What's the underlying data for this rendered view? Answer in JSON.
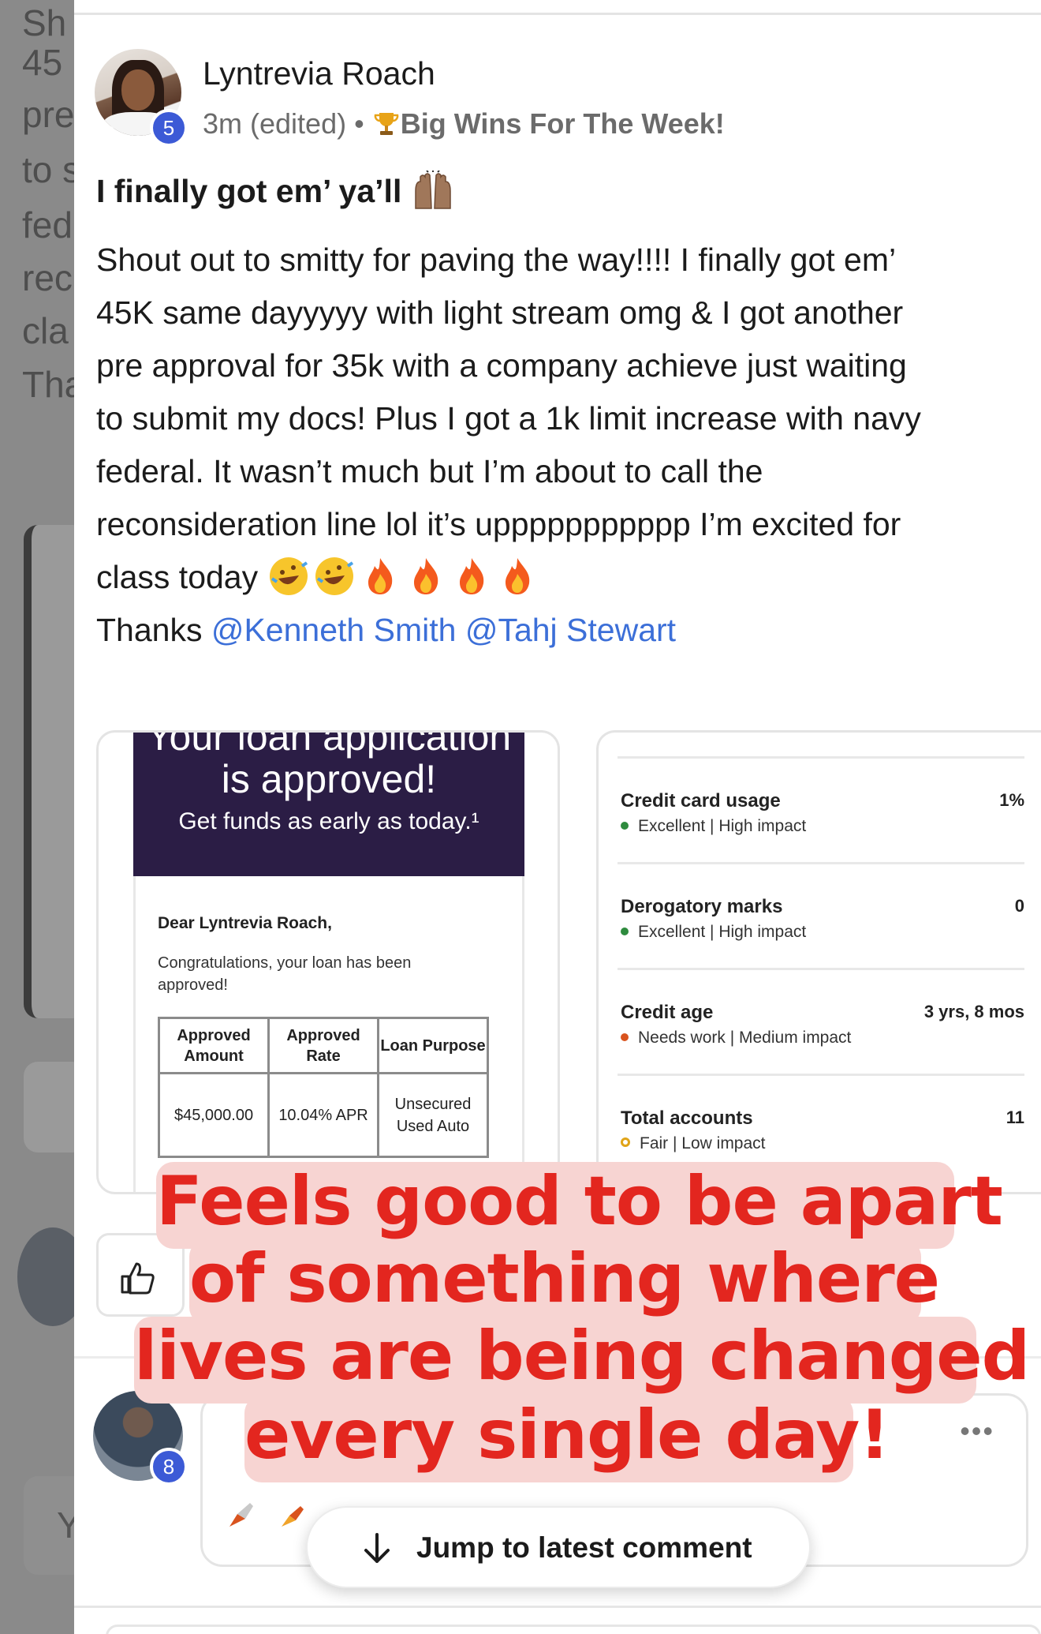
{
  "background": {
    "fragments": [
      "Sh",
      "45",
      "pre",
      "to s",
      "fed",
      "rec",
      "cla",
      "Tha"
    ],
    "bottom_letter": "Y"
  },
  "post": {
    "author": "Lyntrevia Roach",
    "author_level": "5",
    "time": "3m (edited)",
    "separator": "•",
    "category": "Big Wins For The Week!",
    "title": "I finally got em’ ya’ll",
    "body_lines": [
      "Shout out to smitty for paving the way!!!! I finally got em’",
      "45K same dayyyyy with light stream omg & I got another",
      "pre approval for 35k with a company achieve just waiting",
      "to submit my docs! Plus I got a 1k limit increase with navy",
      "federal. It wasn’t much but I’m about to call the",
      "reconsideration line lol it’s uppppppppppp I’m excited for",
      "class today"
    ],
    "thanks_prefix": "Thanks ",
    "mentions": [
      "@Kenneth Smith",
      "@Tahj Stewart"
    ]
  },
  "loan_image": {
    "heading_line1": "Your loan application",
    "heading_line2": "is approved!",
    "subheading": "Get funds as early as today.¹",
    "greeting": "Dear Lyntrevia Roach,",
    "message": "Congratulations, your loan has been approved!",
    "table": {
      "headers": [
        "Approved Amount",
        "Approved Rate",
        "Loan Purpose"
      ],
      "row": [
        "$45,000.00",
        "10.04% APR",
        "Unsecured Used Auto"
      ]
    }
  },
  "credit_image": {
    "factors": [
      {
        "name": "Credit card usage",
        "status": "Excellent | High impact",
        "value": "1%",
        "dot_color": "#2e8b3e"
      },
      {
        "name": "Derogatory marks",
        "status": "Excellent | High impact",
        "value": "0",
        "dot_color": "#2e8b3e"
      },
      {
        "name": "Credit age",
        "status": "Needs work | Medium impact",
        "value": "3 yrs, 8 mos",
        "dot_color": "#d9531e"
      },
      {
        "name": "Total accounts",
        "status": "Fair | Low impact",
        "value": "11",
        "dot_color": "#e0a419"
      }
    ]
  },
  "comment": {
    "level": "8",
    "more": "•••"
  },
  "jump_button": {
    "label": "Jump to latest comment"
  },
  "overlay": {
    "lines": [
      "Feels good to be apart",
      "of something where",
      "lives are being changed",
      "every single day!"
    ],
    "text_color": "#e3261f",
    "bg_color": "#f7d4d2"
  },
  "colors": {
    "mention": "#3c6fd8",
    "badge": "#3c5ad6",
    "loan_banner": "#2b1d45"
  }
}
